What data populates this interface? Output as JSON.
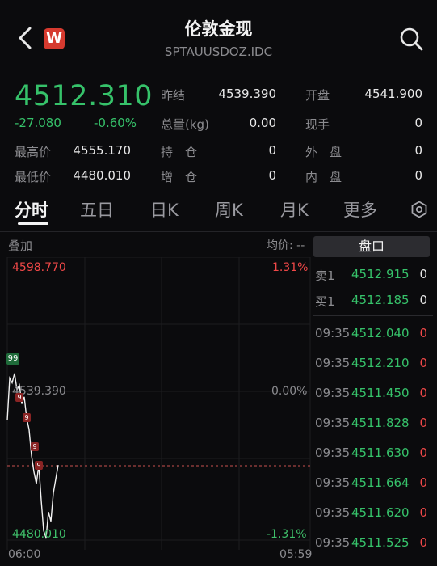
{
  "header": {
    "title": "伦敦金现",
    "code": "SPTAUUSDOZ.IDC",
    "logo_letter": "W"
  },
  "quote": {
    "last": "4512.310",
    "change": "-27.080",
    "change_pct": "-0.60%",
    "fields": [
      {
        "label": "昨结",
        "value": "4539.390"
      },
      {
        "label": "开盘",
        "value": "4541.900"
      },
      {
        "label": "总量(kg)",
        "value": "0.00"
      },
      {
        "label": "现手",
        "value": "0"
      },
      {
        "label": "最高价",
        "value": "4555.170"
      },
      {
        "label": "持　仓",
        "value": "0"
      },
      {
        "label": "外　盘",
        "value": "0"
      },
      {
        "label": "最低价",
        "value": "4480.010"
      },
      {
        "label": "增　仓",
        "value": "0"
      },
      {
        "label": "内　盘",
        "value": "0"
      }
    ]
  },
  "tabs": [
    "分时",
    "五日",
    "日K",
    "周K",
    "月K",
    "更多"
  ],
  "chart": {
    "overlay_label": "叠加",
    "avg_label": "均价: --",
    "high_price": "4598.770",
    "high_pct": "1.31%",
    "mid_price": "4539.390",
    "mid_pct": "0.00%",
    "low_price": "4480.010",
    "low_pct": "-1.31%",
    "time_start": "06:00",
    "time_end": "05:59",
    "marker_top": "99",
    "markers": [
      "9",
      "9",
      "9",
      "9"
    ],
    "line_points": [
      [
        "06:00",
        4531
      ],
      [
        "",
        4549
      ],
      [
        "",
        4547
      ],
      [
        "",
        4551
      ],
      [
        "",
        4544
      ],
      [
        "",
        4546
      ],
      [
        "",
        4538
      ],
      [
        "",
        4541
      ],
      [
        "",
        4532
      ],
      [
        "",
        4527
      ],
      [
        "",
        4516
      ],
      [
        "",
        4509
      ],
      [
        "",
        4504
      ],
      [
        "",
        4512
      ],
      [
        "",
        4497
      ],
      [
        "",
        4484
      ],
      [
        "",
        4481
      ],
      [
        "",
        4492
      ],
      [
        "",
        4488
      ],
      [
        "",
        4500
      ],
      [
        "",
        4506
      ],
      [
        "",
        4512
      ]
    ]
  },
  "orderbook": {
    "title": "盘口",
    "ask": {
      "label": "卖1",
      "price": "4512.915",
      "volume": "0"
    },
    "bid": {
      "label": "买1",
      "price": "4512.185",
      "volume": "0"
    },
    "trades": [
      {
        "time": "09:35",
        "price": "4512.040",
        "volume": "0"
      },
      {
        "time": "09:35",
        "price": "4512.210",
        "volume": "0"
      },
      {
        "time": "09:35",
        "price": "4511.450",
        "volume": "0"
      },
      {
        "time": "09:35",
        "price": "4511.828",
        "volume": "0"
      },
      {
        "time": "09:35",
        "price": "4511.630",
        "volume": "0"
      },
      {
        "time": "09:35",
        "price": "4511.664",
        "volume": "0"
      },
      {
        "time": "09:35",
        "price": "4511.620",
        "volume": "0"
      },
      {
        "time": "09:35",
        "price": "4511.525",
        "volume": "0"
      }
    ]
  },
  "colors": {
    "up": "#f04848",
    "down": "#36c26a",
    "background": "#0b0b0d"
  }
}
